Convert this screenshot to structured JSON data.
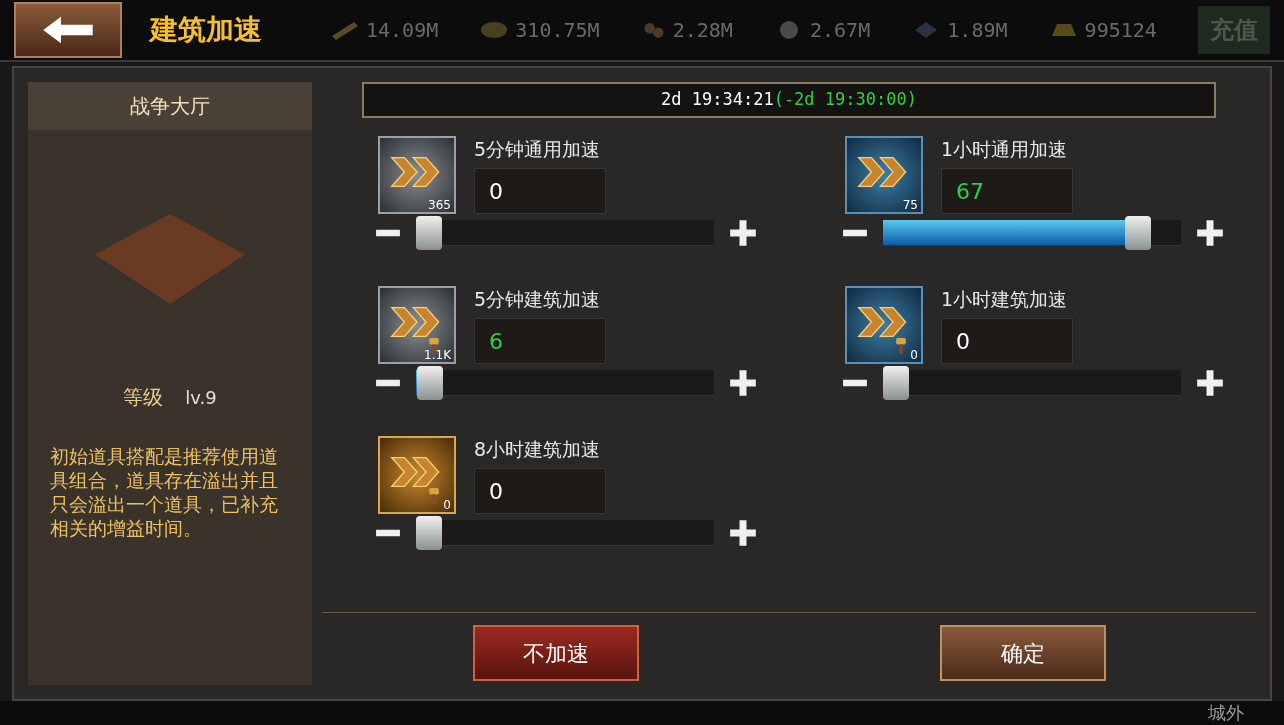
{
  "top_bar": {
    "title": "建筑加速",
    "resources": [
      {
        "kind": "wood",
        "amount": "14.09M"
      },
      {
        "kind": "food",
        "amount": "310.75M"
      },
      {
        "kind": "stone",
        "amount": "2.28M"
      },
      {
        "kind": "iron",
        "amount": "2.67M"
      },
      {
        "kind": "crystal",
        "amount": "1.89M"
      },
      {
        "kind": "gold",
        "amount": "995124"
      }
    ],
    "recharge_button": "充值"
  },
  "building": {
    "name": "战争大厅",
    "level_label": "等级",
    "level": "lv.9",
    "note": "初始道具搭配是推荐使用道具组合，道具存在溢出并且只会溢出一个道具，已补充相关的增益时间。"
  },
  "timer": {
    "remaining": "2d 19:34:21",
    "reduction": "(-2d 19:30:00)"
  },
  "items": [
    {
      "name": "5分钟通用加速",
      "kind": "grey",
      "hammer": false,
      "count": "365",
      "value": "0",
      "changed": false,
      "level": 0
    },
    {
      "name": "1小时通用加速",
      "kind": "blue",
      "hammer": false,
      "count": "75",
      "value": "67",
      "changed": true,
      "level": 0.89
    },
    {
      "name": "5分钟建筑加速",
      "kind": "grey",
      "hammer": true,
      "count": "1.1K",
      "value": "6",
      "changed": true,
      "level": 0.005
    },
    {
      "name": "1小时建筑加速",
      "kind": "blue",
      "hammer": true,
      "count": "0",
      "value": "0",
      "changed": false,
      "level": 0
    },
    {
      "name": "8小时建筑加速",
      "kind": "gold",
      "hammer": true,
      "count": "0",
      "value": "0",
      "changed": false,
      "level": 0
    }
  ],
  "buttons": [
    {
      "label": "不加速",
      "kind": "cancel"
    },
    {
      "label": "确定",
      "kind": "confirm"
    }
  ],
  "bottom_bar": {
    "location": "城外"
  }
}
